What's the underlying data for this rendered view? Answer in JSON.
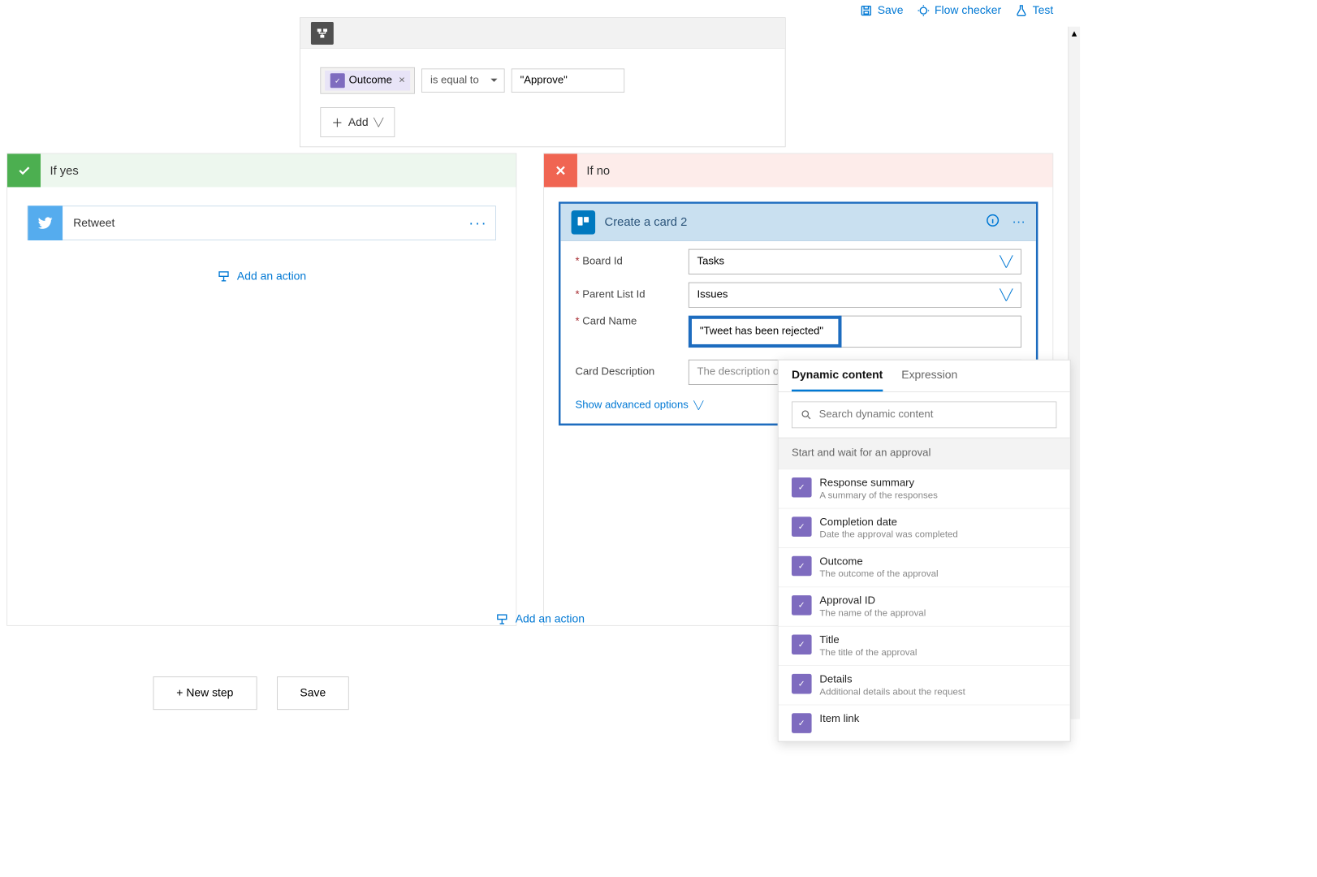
{
  "toolbar": {
    "save": "Save",
    "flow_checker": "Flow checker",
    "test": "Test"
  },
  "condition": {
    "chip_label": "Outcome",
    "operator": "is equal to",
    "value": "\"Approve\"",
    "add": "Add"
  },
  "branch_yes": {
    "label": "If yes"
  },
  "branch_no": {
    "label": "If no"
  },
  "retweet": {
    "title": "Retweet"
  },
  "create_card": {
    "title": "Create a card 2",
    "fields": {
      "board_label": "Board Id",
      "board_value": "Tasks",
      "parent_label": "Parent List Id",
      "parent_value": "Issues",
      "card_name_label": "Card Name",
      "card_name_value": "\"Tweet has been rejected\"",
      "desc_label": "Card Description",
      "desc_placeholder": "The description of the"
    },
    "show_advanced": "Show advanced options"
  },
  "add_action": "Add an action",
  "outer_add_action": "Add an action",
  "footer": {
    "new_step": "+ New step",
    "save": "Save"
  },
  "dynamic": {
    "tabs": {
      "content": "Dynamic content",
      "expression": "Expression"
    },
    "search_placeholder": "Search dynamic content",
    "group": "Start and wait for an approval",
    "items": [
      {
        "title": "Response summary",
        "desc": "A summary of the responses"
      },
      {
        "title": "Completion date",
        "desc": "Date the approval was completed"
      },
      {
        "title": "Outcome",
        "desc": "The outcome of the approval"
      },
      {
        "title": "Approval ID",
        "desc": "The name of the approval"
      },
      {
        "title": "Title",
        "desc": "The title of the approval"
      },
      {
        "title": "Details",
        "desc": "Additional details about the request"
      },
      {
        "title": "Item link",
        "desc": ""
      }
    ]
  }
}
